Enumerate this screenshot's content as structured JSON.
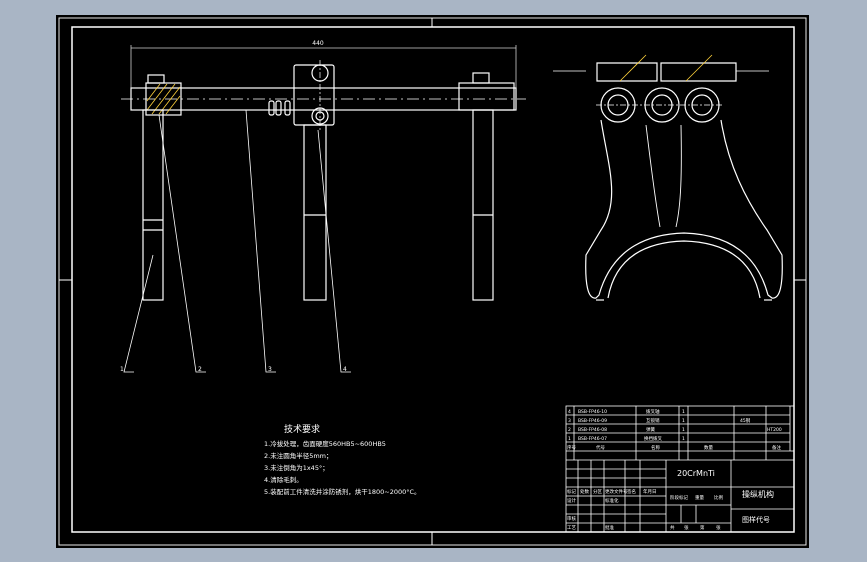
{
  "colors": {
    "viewport_bg": "#a9b5c5",
    "sheet_bg": "#000000",
    "line": "#ffffff",
    "center_line": "#ffffff",
    "hatch": "#ffd23c",
    "dim_line": "#cfcfcf"
  },
  "drawing": {
    "dimension_label": "440",
    "balloons": [
      "1",
      "2",
      "3",
      "4"
    ]
  },
  "notes": {
    "title": "技术要求",
    "items": [
      "1.冷拔处理，齿面硬度560HB5~600HB5",
      "2.未注圆角半径5mm；",
      "3.未注倒角为1x45°；",
      "4.清除毛刺。",
      "5.装配前工件清洗并涂防锈剂，烘干1800~2000°C。"
    ]
  },
  "title_block": {
    "parts_list": [
      {
        "no": "4",
        "code": "BSB-FP46-10",
        "name": "拨叉轴",
        "qty": "1",
        "note": ""
      },
      {
        "no": "3",
        "code": "BSB-FP46-09",
        "name": "互锁销",
        "qty": "1",
        "note": "45钢"
      },
      {
        "no": "2",
        "code": "BSB-FP46-08",
        "name": "弹簧",
        "qty": "1",
        "note": ""
      },
      {
        "no": "1",
        "code": "BSB-FP46-07",
        "name": "换挡拨叉",
        "qty": "1",
        "note": "HT200"
      }
    ],
    "header": {
      "no": "序号",
      "code": "代号",
      "name": "名称",
      "qty": "数量",
      "note": "备注"
    },
    "material": "20CrMnTi",
    "drawing_name": "操纵机构",
    "drawing_code": "图样代号",
    "sign_row": [
      "标记",
      "处数",
      "分区",
      "更改文件号",
      "签名",
      "年月日"
    ],
    "design_row": [
      "设计",
      "",
      "标准化",
      ""
    ],
    "stage_labels": [
      "阶段标记",
      "重量",
      "比例"
    ],
    "review_row": [
      "审核",
      "",
      "批准",
      ""
    ],
    "sheet_labels": [
      "共",
      "张",
      "第",
      "张"
    ],
    "process": "工艺"
  }
}
